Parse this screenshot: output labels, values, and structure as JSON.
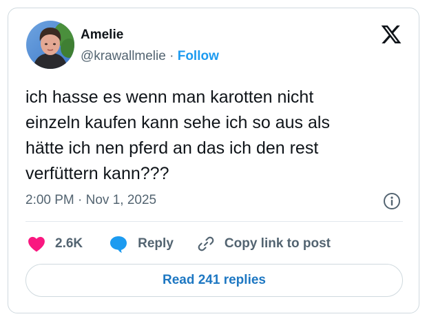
{
  "author": {
    "name": "Amelie",
    "handle": "@krawallmelie",
    "separator": " · ",
    "follow_label": "Follow"
  },
  "tweet": {
    "lines": [
      "ich hasse es wenn man karotten nicht",
      "einzeln kaufen kann sehe ich so aus als",
      "hätte ich nen pferd an das ich den rest",
      "verfüttern kann???"
    ],
    "timestamp": "2:00 PM · Nov 1, 2025"
  },
  "actions": {
    "like_count": "2.6K",
    "reply_label": "Reply",
    "copy_link_label": "Copy link to post"
  },
  "read_replies_label": "Read 241 replies",
  "icons": {
    "logo": "x-logo-icon",
    "info": "info-icon",
    "like": "heart-icon",
    "reply": "speech-bubble-icon",
    "copy": "link-icon"
  },
  "colors": {
    "accent": "#1d9bf0",
    "like": "#f91880",
    "reply_bubble": "#1d9bf0",
    "read_replies_text": "#1d77c2",
    "muted_text": "#536471"
  }
}
